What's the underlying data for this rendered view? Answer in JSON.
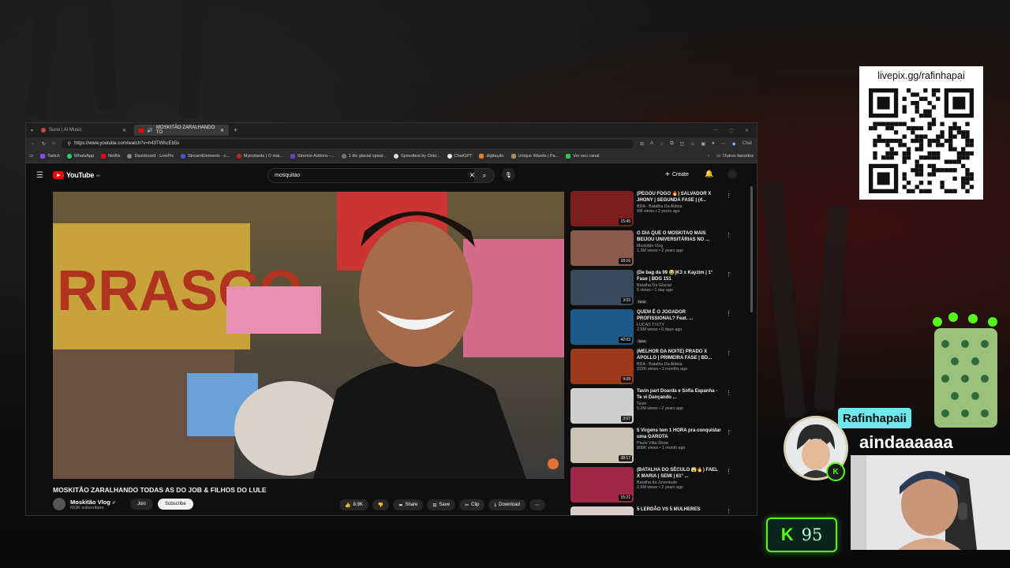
{
  "browser": {
    "tabs": [
      {
        "label": "Suno | AI Music",
        "active": false
      },
      {
        "label": "MOSKITÃO ZARALHANDO TO",
        "active": true
      }
    ],
    "url": "https://www.youtube.com/watch?v=h43TWhcEb5s",
    "chat_label": "Chat",
    "bookmarks": [
      {
        "label": "Twitch",
        "color": "#9146ff"
      },
      {
        "label": "WhatsApp",
        "color": "#25d366"
      },
      {
        "label": "Netflix",
        "color": "#e50914"
      },
      {
        "label": "Dashboard - LivePix",
        "color": "#888888"
      },
      {
        "label": "StreamElements - c...",
        "color": "#3b5bdb"
      },
      {
        "label": "Myinstants | O mai...",
        "color": "#cc2222"
      },
      {
        "label": "Stremio Addons -...",
        "color": "#6c3fb5"
      },
      {
        "label": "1 div glacial spear...",
        "color": "#777777"
      },
      {
        "label": "Speedtest by Ookl...",
        "color": "#dddddd"
      },
      {
        "label": "ChatGPT",
        "color": "#eeeeee"
      },
      {
        "label": "digitação",
        "color": "#e67e22"
      },
      {
        "label": "Unique Wands | Pa...",
        "color": "#b08d57"
      },
      {
        "label": "Ver seu canal",
        "color": "#2ecc40"
      }
    ],
    "other_bookmarks": "Outros favoritos"
  },
  "youtube": {
    "logo_text": "YouTube",
    "logo_sup": "BR",
    "search_value": "mosquitao",
    "create_label": "Create",
    "video_title": "MOSKITÃO ZARALHANDO TODAS AS DO JOB & FILHOS DO LULE",
    "channel_name": "Moskitão Vlog",
    "channel_subs": "653K subscribers",
    "join_label": "Join",
    "subscribe_label": "Subscribe",
    "actions": {
      "likes": "8.9K",
      "share": "Share",
      "save": "Save",
      "clip": "Clip",
      "download": "Download"
    },
    "related": [
      {
        "title": "(PEGOU FOGO 🔥) SALVADOR X JHONY | SEGUNDA FASE | (4...",
        "channel": "BDA - Batalha Da Aldeia",
        "meta": "6M views • 2 years ago",
        "duration": "15:45",
        "color": "#7a1e1e",
        "new": ""
      },
      {
        "title": "O DIA QUE O MOSKITAO MAIS BEIJOU UNIVERSITÁRIAS NO ...",
        "channel": "Moskitão Vlog",
        "meta": "1.3M views • 2 years ago",
        "duration": "18:16",
        "color": "#8a5a4a",
        "new": ""
      },
      {
        "title": "(De bag da 99 😂)K3 x Kayzim | 1° Fase | BDG 151",
        "channel": "Batalha Da Glacial",
        "meta": "5 views • 1 day ago",
        "duration": "3:03",
        "color": "#3a4a5a",
        "new": "New"
      },
      {
        "title": "QUEM É O JOGADOR PROFISSIONAL? Feat. ...",
        "channel": "LUCAS TYLTY",
        "meta": "2.5M views • 6 days ago",
        "duration": "42:03",
        "color": "#1e5a8a",
        "new": "New"
      },
      {
        "title": "(MELHOR DA NOITE) PRADO X APOLLO | PRIMEIRA FASE | BD...",
        "channel": "BDA - Batalha Da Aldeia",
        "meta": "222K views • 2 months ago",
        "duration": "9:08",
        "color": "#9a3a1a",
        "new": ""
      },
      {
        "title": "Tavin part Doarda e Sofia Espanha - Te vi Dançando ...",
        "channel": "Tavin",
        "meta": "5.2M views • 2 years ago",
        "duration": "3:07",
        "color": "#cfcfcf",
        "new": ""
      },
      {
        "title": "5 Virgens tem 1 HORA pra conquistar uma GAROTA",
        "channel": "Paulo Vitta Show",
        "meta": "808K views • 1 month ago",
        "duration": "38:17",
        "color": "#c9c2b5",
        "new": ""
      },
      {
        "title": "(BATALHA DO SÉCULO 😱🔥) FAEL X MARIA | SEMI | 61° ...",
        "channel": "Batalha da Juventude",
        "meta": "2.5M views • 2 years ago",
        "duration": "15:21",
        "color": "#a0284a",
        "new": ""
      },
      {
        "title": "5 LERDÃO VS 5 MULHERES",
        "channel": "",
        "meta": "",
        "duration": "",
        "color": "#d8d0c8",
        "new": ""
      }
    ]
  },
  "overlay": {
    "livepix_label": "livepix.gg/rafinhapai",
    "chat_user": "Rafinhapaii",
    "chat_message": "aindaaaaaa",
    "kick_letter": "K",
    "viewer_count": "95"
  },
  "colors": {
    "yt_red": "#ff0000",
    "kick_green": "#53fc18",
    "chat_badge": "#6ee8ee"
  }
}
